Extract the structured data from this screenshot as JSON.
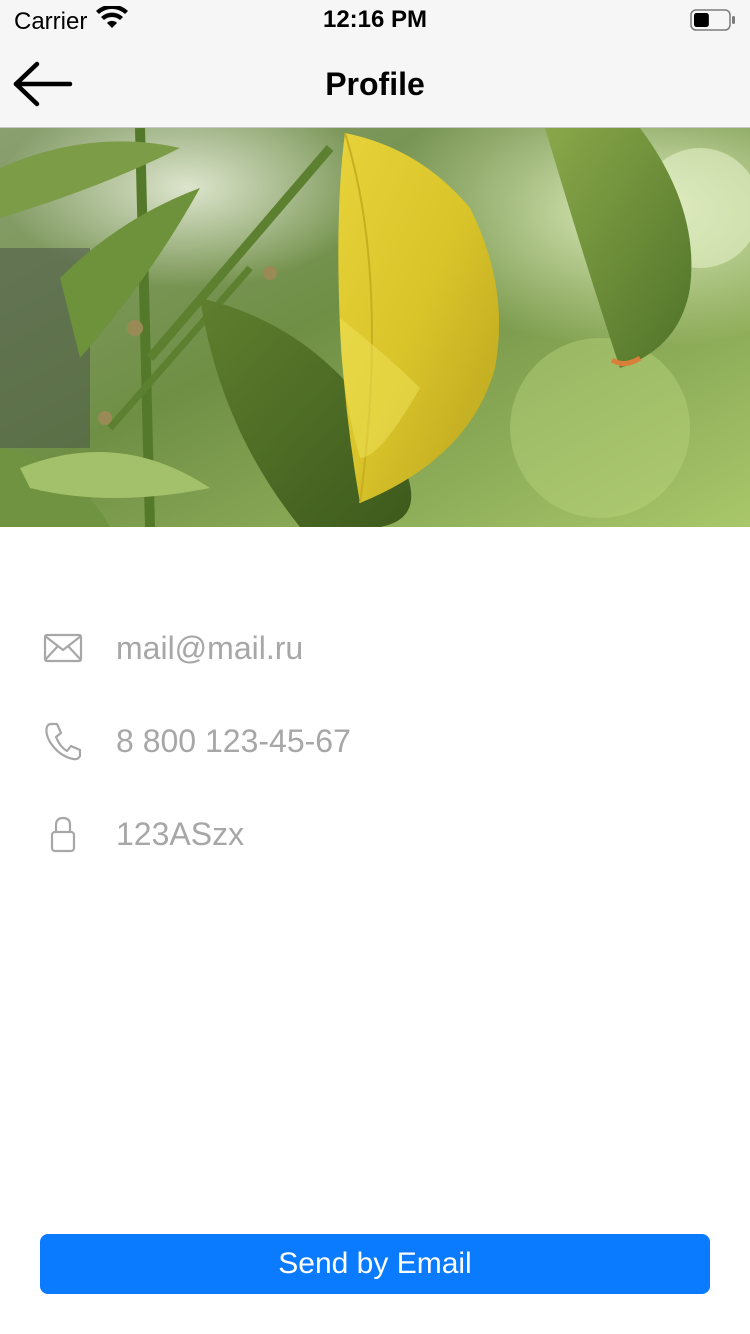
{
  "status_bar": {
    "carrier": "Carrier",
    "time": "12:16 PM",
    "battery_level": 0.45
  },
  "nav": {
    "title": "Profile",
    "back_icon": "arrow-left-icon"
  },
  "profile": {
    "fields": [
      {
        "icon": "envelope-icon",
        "value": "mail@mail.ru"
      },
      {
        "icon": "phone-icon",
        "value": "8 800 123-45-67"
      },
      {
        "icon": "lock-icon",
        "value": "123ASzx"
      }
    ]
  },
  "actions": {
    "send_label": "Send by Email"
  },
  "colors": {
    "accent": "#0a7aff",
    "value_text": "#a7a7a7",
    "icon": "#a7a7a7",
    "nav_background": "#f6f6f6"
  }
}
